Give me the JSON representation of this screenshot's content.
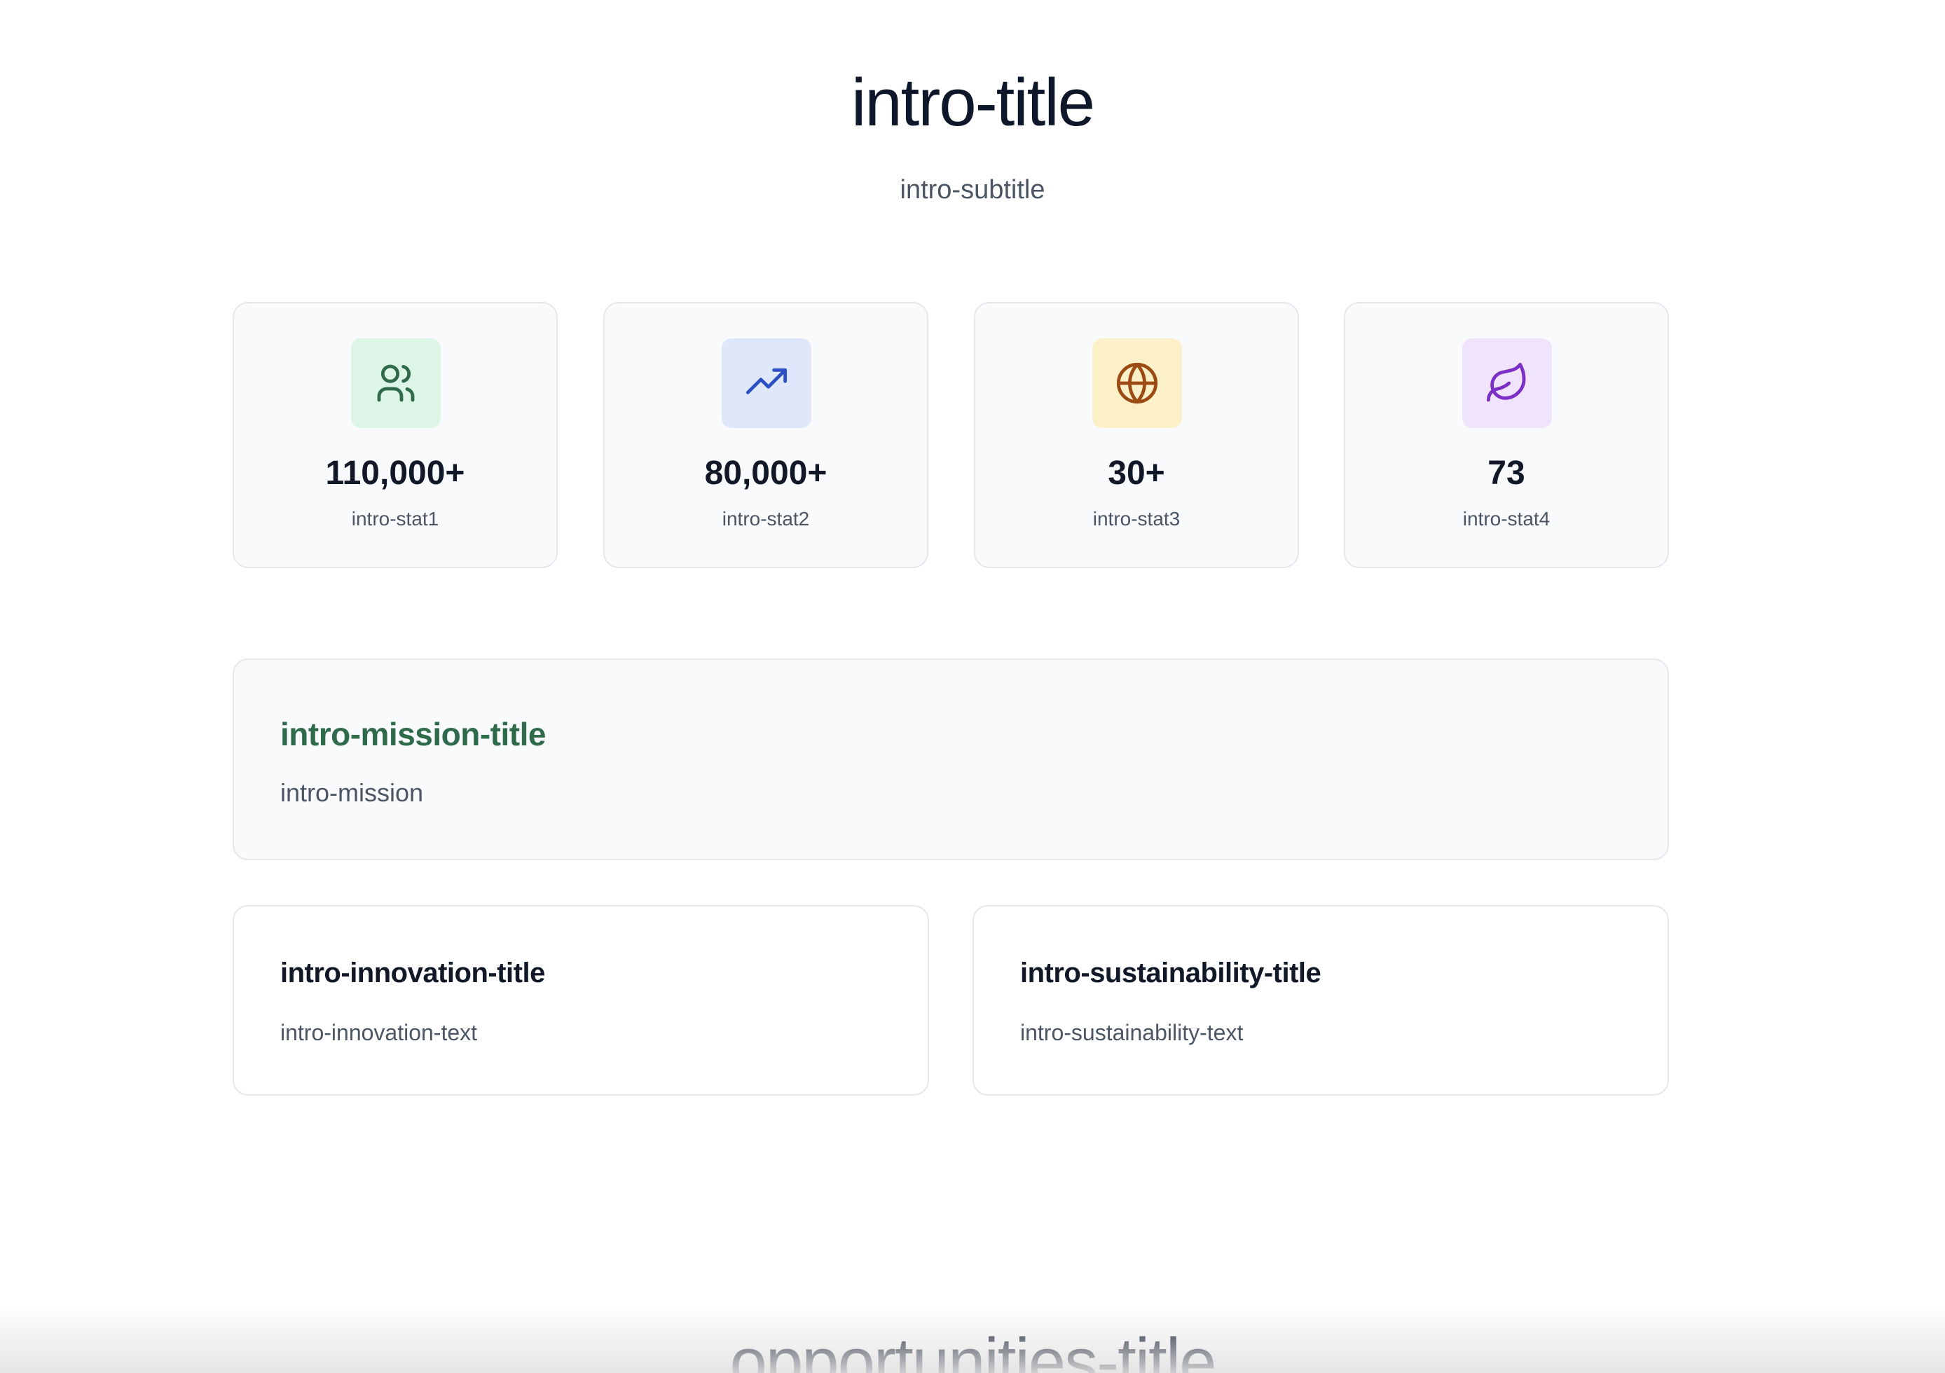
{
  "intro": {
    "title": "intro-title",
    "subtitle": "intro-subtitle",
    "stats": [
      {
        "value": "110,000+",
        "label": "intro-stat1",
        "icon": "users-icon",
        "icon_bg": "#dcf5e6",
        "icon_color": "#2f6b4b"
      },
      {
        "value": "80,000+",
        "label": "intro-stat2",
        "icon": "trending-up-icon",
        "icon_bg": "#dfe8fb",
        "icon_color": "#2d4fc4"
      },
      {
        "value": "30+",
        "label": "intro-stat3",
        "icon": "globe-icon",
        "icon_bg": "#fbf0c8",
        "icon_color": "#9a4a12"
      },
      {
        "value": "73",
        "label": "intro-stat4",
        "icon": "leaf-icon",
        "icon_bg": "#efe4fb",
        "icon_color": "#7b2fc4"
      }
    ],
    "mission": {
      "title": "intro-mission-title",
      "text": "intro-mission",
      "title_color": "#2f6b4b"
    },
    "innovation": {
      "title": "intro-innovation-title",
      "text": "intro-innovation-text"
    },
    "sustainability": {
      "title": "intro-sustainability-title",
      "text": "intro-sustainability-text"
    }
  },
  "opportunities": {
    "title": "opportunities-title"
  }
}
